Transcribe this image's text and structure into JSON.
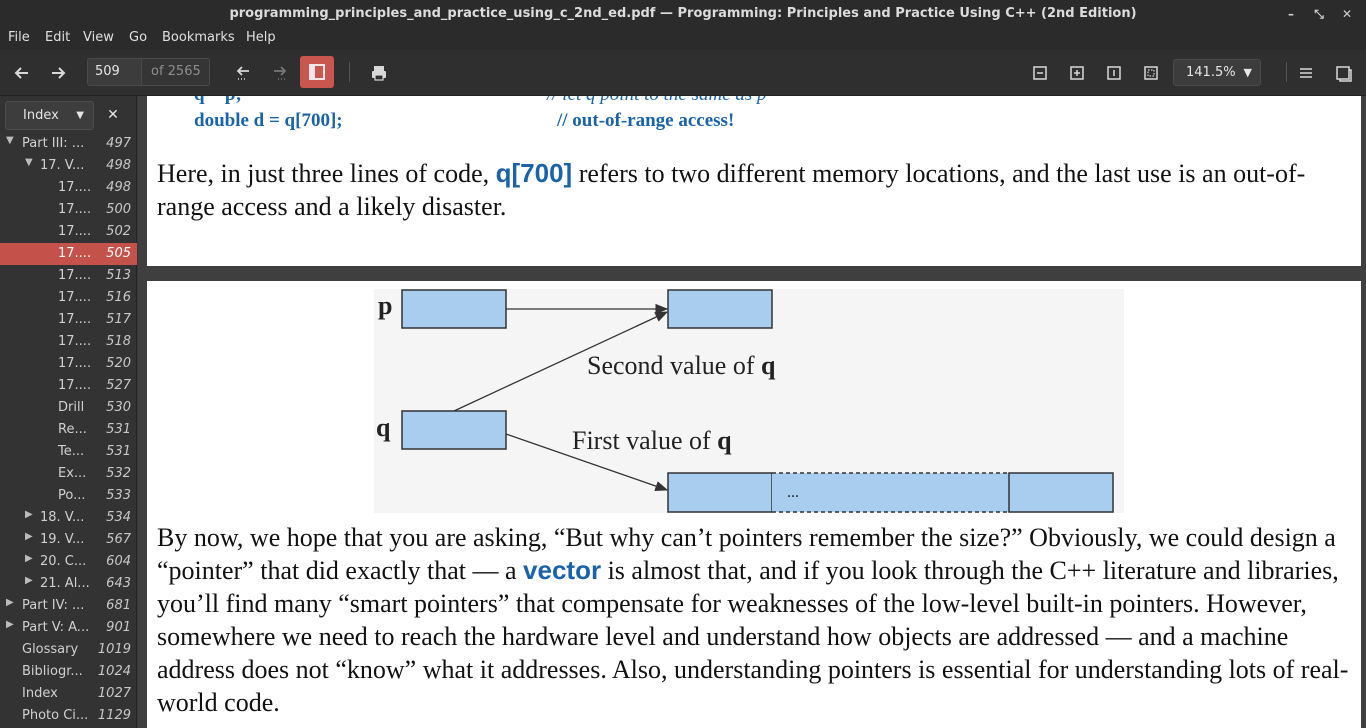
{
  "window": {
    "title": "programming_principles_and_practice_using_c_2nd_ed.pdf — Programming: Principles and Practice Using C++ (2nd Edition)"
  },
  "menu": [
    "File",
    "Edit",
    "View",
    "Go",
    "Bookmarks",
    "Help"
  ],
  "toolbar": {
    "page_current": "509",
    "page_total": "of 2565",
    "zoom": "141.5%"
  },
  "sidebar": {
    "mode": "Index",
    "items": [
      {
        "label": "Part III: ...",
        "page": "497",
        "level": 0,
        "expander": "▼"
      },
      {
        "label": "17. V...",
        "page": "498",
        "level": 1,
        "expander": "▼"
      },
      {
        "label": "17....",
        "page": "498",
        "level": 2,
        "expander": ""
      },
      {
        "label": "17....",
        "page": "500",
        "level": 2,
        "expander": ""
      },
      {
        "label": "17....",
        "page": "502",
        "level": 2,
        "expander": ""
      },
      {
        "label": "17....",
        "page": "505",
        "level": 2,
        "expander": "",
        "selected": true
      },
      {
        "label": "17....",
        "page": "513",
        "level": 2,
        "expander": ""
      },
      {
        "label": "17....",
        "page": "516",
        "level": 2,
        "expander": ""
      },
      {
        "label": "17....",
        "page": "517",
        "level": 2,
        "expander": ""
      },
      {
        "label": "17....",
        "page": "518",
        "level": 2,
        "expander": ""
      },
      {
        "label": "17....",
        "page": "520",
        "level": 2,
        "expander": ""
      },
      {
        "label": "17....",
        "page": "527",
        "level": 2,
        "expander": ""
      },
      {
        "label": "Drill",
        "page": "530",
        "level": 2,
        "expander": ""
      },
      {
        "label": "Re...",
        "page": "531",
        "level": 2,
        "expander": ""
      },
      {
        "label": "Te...",
        "page": "531",
        "level": 2,
        "expander": ""
      },
      {
        "label": "Ex...",
        "page": "532",
        "level": 2,
        "expander": ""
      },
      {
        "label": "Po...",
        "page": "533",
        "level": 2,
        "expander": ""
      },
      {
        "label": "18. V...",
        "page": "534",
        "level": 1,
        "expander": "▶"
      },
      {
        "label": "19. V...",
        "page": "567",
        "level": 1,
        "expander": "▶"
      },
      {
        "label": "20. C...",
        "page": "604",
        "level": 1,
        "expander": "▶"
      },
      {
        "label": "21. Al...",
        "page": "643",
        "level": 1,
        "expander": "▶"
      },
      {
        "label": "Part IV: ...",
        "page": "681",
        "level": 0,
        "expander": "▶"
      },
      {
        "label": "Part V: A...",
        "page": "901",
        "level": 0,
        "expander": "▶"
      },
      {
        "label": "Glossary",
        "page": "1019",
        "level": 0,
        "expander": ""
      },
      {
        "label": "Bibliogr...",
        "page": "1024",
        "level": 0,
        "expander": ""
      },
      {
        "label": "Index",
        "page": "1027",
        "level": 0,
        "expander": ""
      },
      {
        "label": "Photo Ci...",
        "page": "1129",
        "level": 0,
        "expander": ""
      }
    ]
  },
  "document": {
    "code_line1_left": "q = p;",
    "code_line1_comment": "// let q point to the same as p",
    "code_line2_left": "double d = q[700];",
    "code_line2_comment": "// out-of-range access!",
    "para1_before": "Here, in just three lines of code, ",
    "para1_code": "q[700]",
    "para1_after": " refers to two different memory locations, and the last use is an out-of-range access and a likely disaster.",
    "figure": {
      "label_p": "p",
      "label_q": "q",
      "second_value": "Second value of ",
      "first_value": "First value of ",
      "q_bold": "q",
      "ellipsis": "..."
    },
    "para2_before": "By now, we hope that you are asking, “But why can’t pointers remember the size?” Obviously, we could design a “pointer” that did exactly that — a ",
    "para2_code": "vector",
    "para2_after": " is almost that, and if you look through the C++ literature and libraries, you’ll find many “smart pointers” that compensate for weaknesses of the low-level built-in pointers. However, somewhere we need to reach the hardware level and understand how objects are addressed — and a machine address does not “know” what it addresses. Also, understanding pointers is essential for understanding lots of real-world code."
  },
  "colors": {
    "accent": "#c4514a",
    "code_blue": "#1a63a8",
    "figure_box": "#a9cdef"
  }
}
